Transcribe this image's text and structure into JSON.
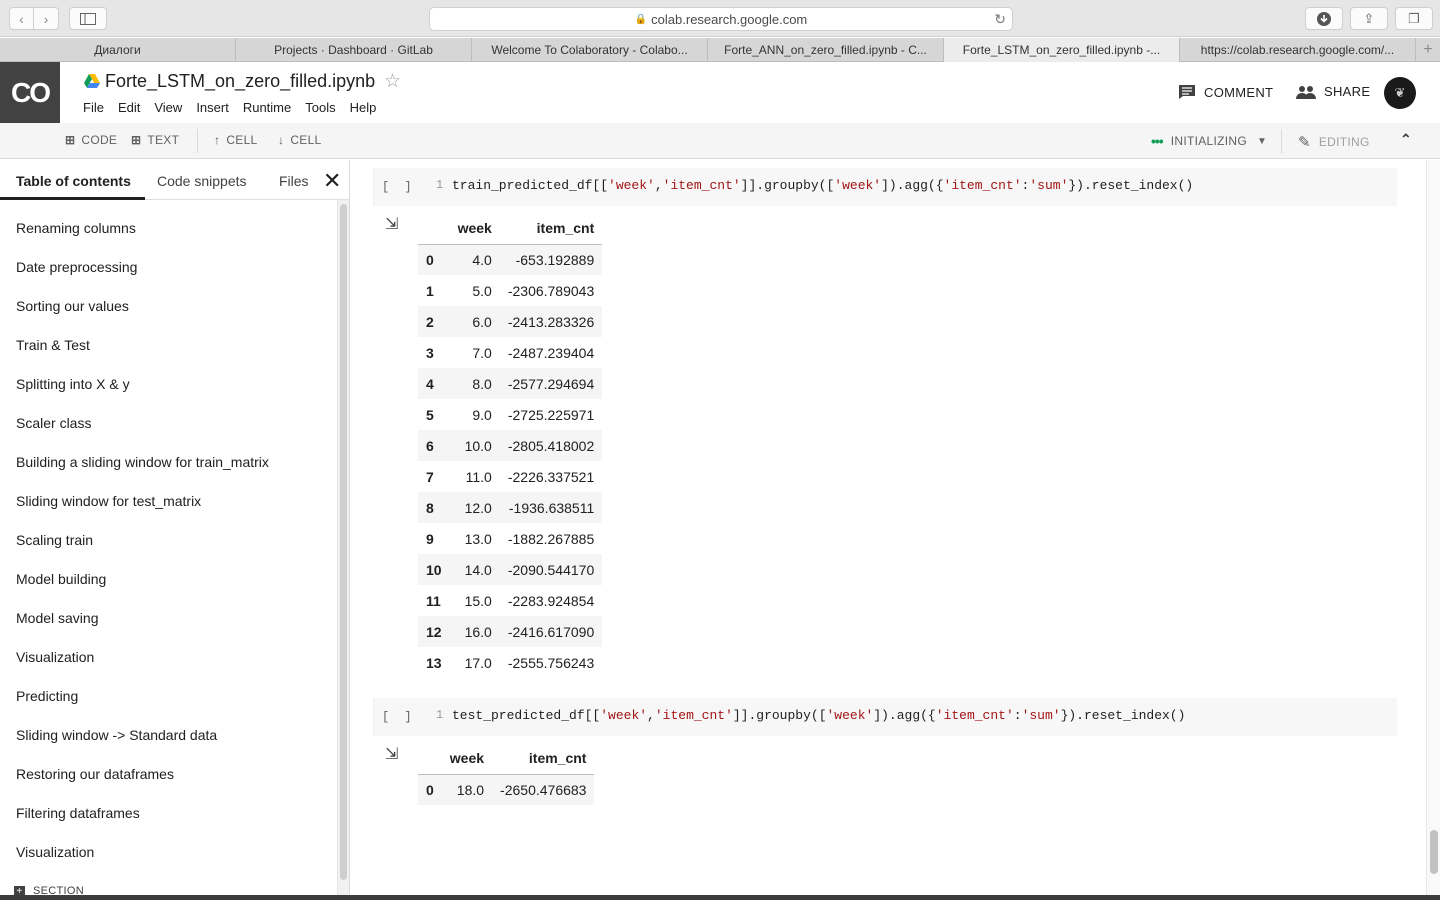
{
  "browser": {
    "url": "colab.research.google.com",
    "tabs": [
      "Диалоги",
      "Projects · Dashboard · GitLab",
      "Welcome To Colaboratory - Colabo...",
      "Forte_ANN_on_zero_filled.ipynb - C...",
      "Forte_LSTM_on_zero_filled.ipynb -...",
      "https://colab.research.google.com/..."
    ],
    "active_tab": 4
  },
  "header": {
    "logo": "CO",
    "title": "Forte_LSTM_on_zero_filled.ipynb",
    "menu": [
      "File",
      "Edit",
      "View",
      "Insert",
      "Runtime",
      "Tools",
      "Help"
    ],
    "comment_label": "COMMENT",
    "share_label": "SHARE"
  },
  "toolbar": {
    "code_label": "CODE",
    "text_label": "TEXT",
    "cell_up_label": "CELL",
    "cell_down_label": "CELL",
    "status_label": "INITIALIZING",
    "editing_label": "EDITING"
  },
  "sidebar": {
    "tabs": [
      "Table of contents",
      "Code snippets",
      "Files"
    ],
    "active_tab": 0,
    "toc": [
      "Renaming columns",
      "Date preprocessing",
      "Sorting our values",
      "Train & Test",
      "Splitting into X & y",
      "Scaler class",
      "Building a sliding window for train_matrix",
      "Sliding window for test_matrix",
      "Scaling train",
      "Model building",
      "Model saving",
      "Visualization",
      "Predicting",
      "Sliding window -> Standard data",
      "Restoring our dataframes",
      "Filtering dataframes",
      "Visualization"
    ],
    "add_section_label": "SECTION"
  },
  "cells": [
    {
      "run_label": "[ ]",
      "line_no": "1",
      "code_segments": [
        {
          "t": "train_predicted_df[[",
          "c": ""
        },
        {
          "t": "'week'",
          "c": "str"
        },
        {
          "t": ",",
          "c": ""
        },
        {
          "t": "'item_cnt'",
          "c": "str"
        },
        {
          "t": "]].groupby([",
          "c": ""
        },
        {
          "t": "'week'",
          "c": "str"
        },
        {
          "t": "]).agg({",
          "c": ""
        },
        {
          "t": "'item_cnt'",
          "c": "str"
        },
        {
          "t": ":",
          "c": ""
        },
        {
          "t": "'sum'",
          "c": "str"
        },
        {
          "t": "}).reset_index()",
          "c": ""
        }
      ],
      "output": {
        "columns": [
          "",
          "week",
          "item_cnt"
        ],
        "rows": [
          [
            "0",
            "4.0",
            "-653.192889"
          ],
          [
            "1",
            "5.0",
            "-2306.789043"
          ],
          [
            "2",
            "6.0",
            "-2413.283326"
          ],
          [
            "3",
            "7.0",
            "-2487.239404"
          ],
          [
            "4",
            "8.0",
            "-2577.294694"
          ],
          [
            "5",
            "9.0",
            "-2725.225971"
          ],
          [
            "6",
            "10.0",
            "-2805.418002"
          ],
          [
            "7",
            "11.0",
            "-2226.337521"
          ],
          [
            "8",
            "12.0",
            "-1936.638511"
          ],
          [
            "9",
            "13.0",
            "-1882.267885"
          ],
          [
            "10",
            "14.0",
            "-2090.544170"
          ],
          [
            "11",
            "15.0",
            "-2283.924854"
          ],
          [
            "12",
            "16.0",
            "-2416.617090"
          ],
          [
            "13",
            "17.0",
            "-2555.756243"
          ]
        ]
      }
    },
    {
      "run_label": "[ ]",
      "line_no": "1",
      "code_segments": [
        {
          "t": "test_predicted_df[[",
          "c": ""
        },
        {
          "t": "'week'",
          "c": "str"
        },
        {
          "t": ",",
          "c": ""
        },
        {
          "t": "'item_cnt'",
          "c": "str"
        },
        {
          "t": "]].groupby([",
          "c": ""
        },
        {
          "t": "'week'",
          "c": "str"
        },
        {
          "t": "]).agg({",
          "c": ""
        },
        {
          "t": "'item_cnt'",
          "c": "str"
        },
        {
          "t": ":",
          "c": ""
        },
        {
          "t": "'sum'",
          "c": "str"
        },
        {
          "t": "}).reset_index()",
          "c": ""
        }
      ],
      "output": {
        "columns": [
          "",
          "week",
          "item_cnt"
        ],
        "rows": [
          [
            "0",
            "18.0",
            "-2650.476683"
          ]
        ]
      }
    }
  ]
}
